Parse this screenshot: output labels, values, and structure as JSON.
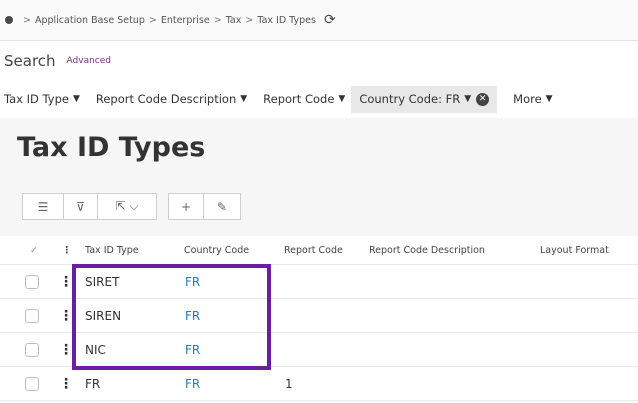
{
  "breadcrumb": {
    "items": [
      "Application Base Setup",
      "Enterprise",
      "Tax",
      "Tax ID Types"
    ],
    "separator": ">",
    "refresh_icon": "refresh-icon"
  },
  "search": {
    "title": "Search",
    "advanced_label": "Advanced"
  },
  "filters": [
    {
      "label": "Tax ID Type"
    },
    {
      "label": "Report Code Description"
    },
    {
      "label": "Report Code"
    },
    {
      "label": "Country Code: FR"
    },
    {
      "label": "More"
    }
  ],
  "page": {
    "title": "Tax ID Types"
  },
  "toolbar": {
    "buttons": [
      {
        "icon": "list-icon",
        "glyph": "☰"
      },
      {
        "icon": "filter-icon",
        "glyph": "⊽"
      },
      {
        "icon": "export-icon",
        "glyph": "⇱ ⌵"
      },
      {
        "icon": "add-icon",
        "glyph": "+"
      },
      {
        "icon": "edit-icon",
        "glyph": "✎"
      }
    ]
  },
  "table": {
    "headers": [
      "Tax ID Type",
      "Country Code",
      "Report Code",
      "Report Code Description",
      "Layout Format"
    ],
    "rows": [
      {
        "tax_id_type": "SIRET",
        "country_code": "FR",
        "report_code": "",
        "report_code_description": "",
        "layout_format": ""
      },
      {
        "tax_id_type": "SIREN",
        "country_code": "FR",
        "report_code": "",
        "report_code_description": "",
        "layout_format": ""
      },
      {
        "tax_id_type": "NIC",
        "country_code": "FR",
        "report_code": "",
        "report_code_description": "",
        "layout_format": ""
      },
      {
        "tax_id_type": "FR",
        "country_code": "FR",
        "report_code": "1",
        "report_code_description": "",
        "layout_format": ""
      }
    ]
  },
  "colors": {
    "highlight": "#6a1fa2",
    "link": "#2a7ab8",
    "advanced": "#7a2a8c"
  }
}
